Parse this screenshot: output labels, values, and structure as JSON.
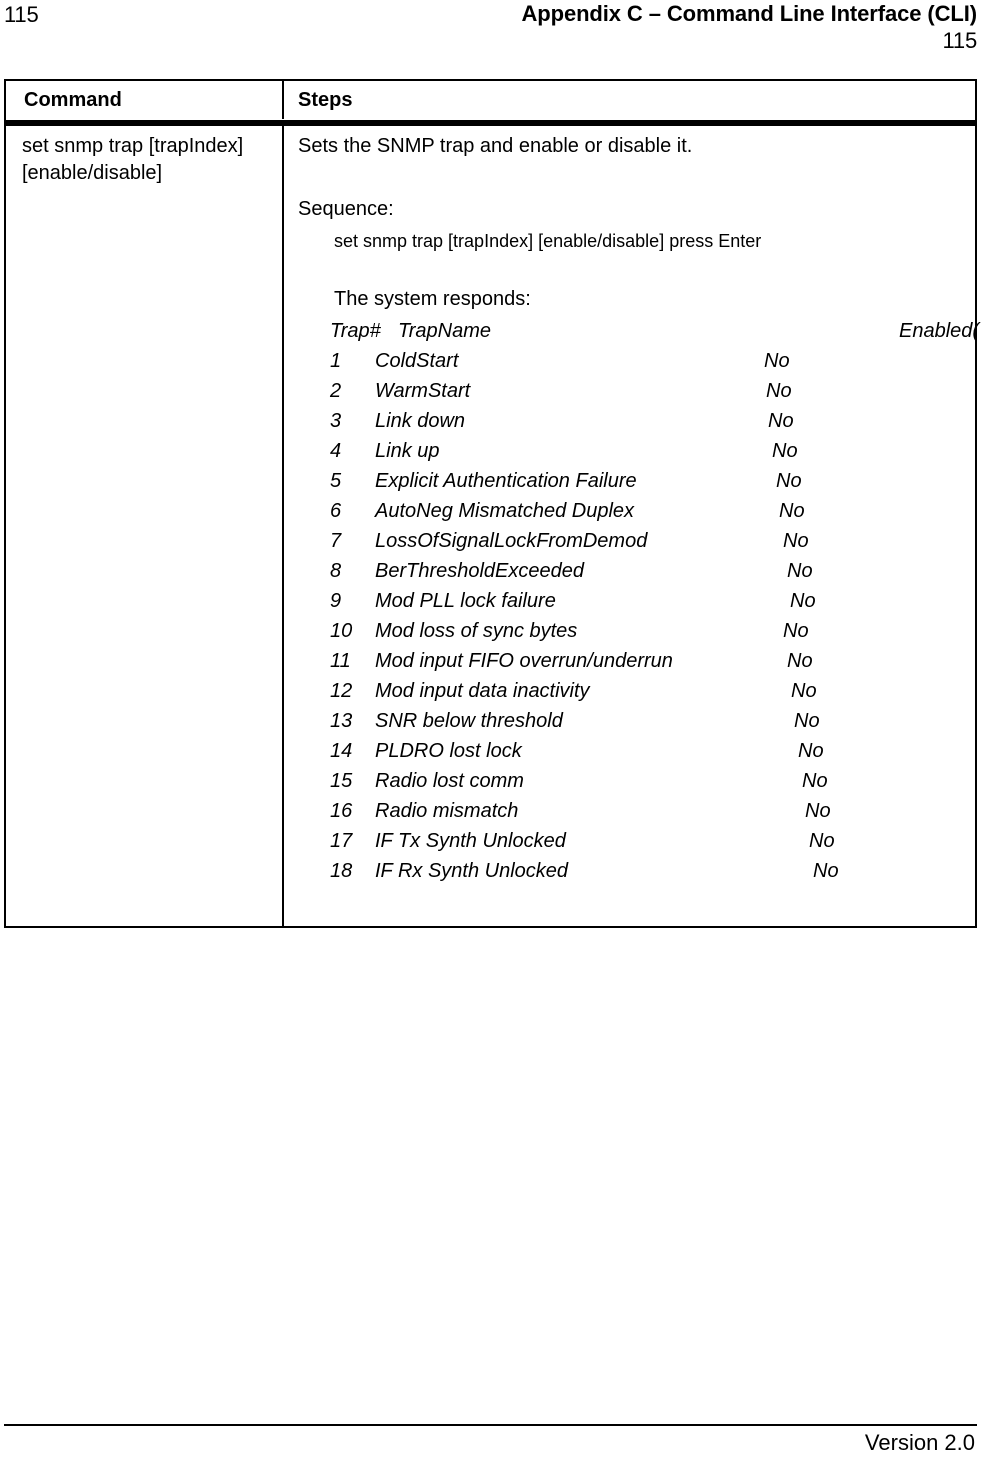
{
  "header": {
    "page_number_left": "115",
    "title": "Appendix C – Command Line Interface (CLI)",
    "page_number_right": "115"
  },
  "table": {
    "columns": {
      "command": "Command",
      "steps": "Steps"
    },
    "row": {
      "command_line_1": "set snmp trap [trapIndex]",
      "command_line_2": "[enable/disable]",
      "steps": {
        "description": "Sets the SNMP trap and enable or disable it.",
        "sequence_label": "Sequence:",
        "sequence_command": "set snmp trap [trapIndex] [enable/disable] press Enter",
        "response_label": "The system responds:",
        "trap_table": {
          "headers": {
            "index": "Trap#",
            "name": "TrapName",
            "enabled": "Enabled(Yes | No)"
          },
          "header_value_offset": 601,
          "rows": [
            {
              "index": "1",
              "name": "ColdStart",
              "enabled": "No",
              "value_offset": 466
            },
            {
              "index": "2",
              "name": "WarmStart",
              "enabled": "No",
              "value_offset": 468
            },
            {
              "index": "3",
              "name": "Link down",
              "enabled": "No",
              "value_offset": 470
            },
            {
              "index": "4",
              "name": "Link up",
              "enabled": "No",
              "value_offset": 474
            },
            {
              "index": "5",
              "name": "Explicit Authentication Failure",
              "enabled": "No",
              "value_offset": 478
            },
            {
              "index": "6",
              "name": "AutoNeg Mismatched Duplex",
              "enabled": "No",
              "value_offset": 481
            },
            {
              "index": "7",
              "name": "LossOfSignalLockFromDemod",
              "enabled": "No",
              "value_offset": 485
            },
            {
              "index": "8",
              "name": "BerThresholdExceeded",
              "enabled": "No",
              "value_offset": 489
            },
            {
              "index": "9",
              "name": "Mod PLL lock failure",
              "enabled": "No",
              "value_offset": 492
            },
            {
              "index": "10",
              "name": "Mod loss of sync bytes",
              "enabled": "No",
              "value_offset": 485
            },
            {
              "index": "11",
              "name": "Mod input FIFO overrun/underrun",
              "enabled": "No",
              "value_offset": 489
            },
            {
              "index": "12",
              "name": "Mod input data inactivity",
              "enabled": "No",
              "value_offset": 493
            },
            {
              "index": "13",
              "name": "SNR below threshold",
              "enabled": "No",
              "value_offset": 496
            },
            {
              "index": "14",
              "name": "PLDRO lost lock",
              "enabled": "No",
              "value_offset": 500
            },
            {
              "index": "15",
              "name": "Radio lost comm",
              "enabled": "No",
              "value_offset": 504
            },
            {
              "index": "16",
              "name": "Radio mismatch",
              "enabled": "No",
              "value_offset": 507
            },
            {
              "index": "17",
              "name": "IF Tx Synth Unlocked",
              "enabled": "No",
              "value_offset": 511
            },
            {
              "index": "18",
              "name": "IF Rx Synth Unlocked",
              "enabled": "No",
              "value_offset": 515
            }
          ]
        }
      }
    }
  },
  "footer": {
    "version": "Version 2.0"
  }
}
